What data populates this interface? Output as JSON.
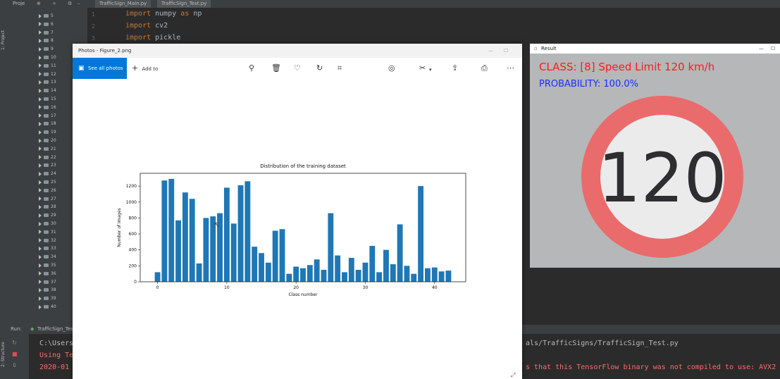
{
  "ide": {
    "tabs": [
      "Proje",
      "TrafficSign_Main.py",
      "TrafficSign_Test.py"
    ],
    "side_label": "1: Project",
    "tree_items": [
      "5",
      "6",
      "7",
      "8",
      "9",
      "10",
      "11",
      "12",
      "13",
      "14",
      "15",
      "16",
      "17",
      "18",
      "19",
      "20",
      "21",
      "22",
      "23",
      "24",
      "25",
      "26",
      "27",
      "28",
      "29",
      "30",
      "31",
      "32",
      "33",
      "34",
      "35",
      "36",
      "37",
      "38",
      "39",
      "40"
    ],
    "line_numbers": [
      "1",
      "2",
      "3"
    ],
    "code": [
      {
        "kw": "import",
        "rest": " numpy ",
        "kw2": "as",
        "rest2": " np"
      },
      {
        "kw": "import",
        "rest": " cv2",
        "kw2": "",
        "rest2": ""
      },
      {
        "kw": "import",
        "rest": " pickle",
        "kw2": "",
        "rest2": ""
      }
    ],
    "run_tab_label": "Run:",
    "run_tab_name": "TrafficSign_Test",
    "structure_label": "2: Structure",
    "console_left": [
      "C:\\Users",
      "Using Te",
      "2020-01"
    ],
    "console_right": [
      "als/TrafficSigns/TrafficSign_Test.py",
      "",
      "s that this TensorFlow binary was not compiled to use: AVX2"
    ]
  },
  "photos": {
    "title": "Photos - Figure_2.png",
    "see_all_label": "See all photos",
    "add_to_label": "Add to",
    "icons": [
      "zoom-icon",
      "delete-icon",
      "favorite-icon",
      "rotate-icon",
      "crop-icon",
      "enhance-icon",
      "edit-icon",
      "share-icon",
      "print-icon",
      "more-icon"
    ]
  },
  "result": {
    "title": "Result",
    "class_text": "CLASS:  [8] Speed Limit 120 km/h",
    "prob_text": "PROBABILITY: 100.0%",
    "sign_text": "120"
  },
  "chart_data": {
    "type": "bar",
    "title": "Distribution of the training dataset",
    "xlabel": "Class number",
    "ylabel": "Number of images",
    "x": [
      0,
      1,
      2,
      3,
      4,
      5,
      6,
      7,
      8,
      9,
      10,
      11,
      12,
      13,
      14,
      15,
      16,
      17,
      18,
      19,
      20,
      21,
      22,
      23,
      24,
      25,
      26,
      27,
      28,
      29,
      30,
      31,
      32,
      33,
      34,
      35,
      36,
      37,
      38,
      39,
      40,
      41,
      42
    ],
    "values": [
      120,
      1270,
      1290,
      770,
      1120,
      1040,
      230,
      800,
      820,
      860,
      1180,
      730,
      1210,
      1260,
      440,
      360,
      240,
      640,
      660,
      100,
      190,
      170,
      210,
      280,
      150,
      860,
      330,
      120,
      300,
      150,
      240,
      450,
      120,
      400,
      220,
      720,
      200,
      100,
      1200,
      170,
      180,
      130,
      140
    ],
    "xticks": [
      0,
      10,
      20,
      30,
      40
    ],
    "yticks": [
      0,
      200,
      400,
      600,
      800,
      1000,
      1200
    ],
    "xlim": [
      -2.5,
      44.5
    ],
    "ylim": [
      0,
      1360
    ],
    "bar_color": "#1f77b4",
    "grid": false
  },
  "colors": {
    "class_text": "#ff1a1a",
    "prob_text": "#1a2cff",
    "accent": "#0078d7"
  }
}
